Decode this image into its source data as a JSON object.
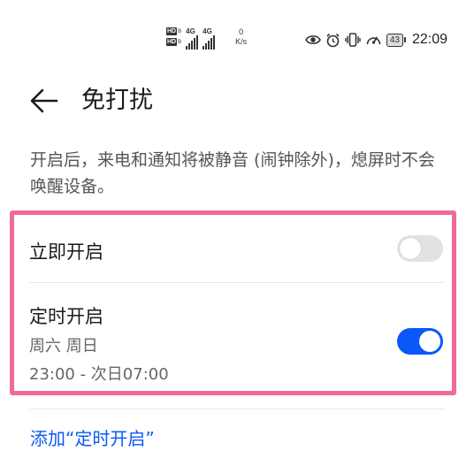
{
  "status_bar": {
    "hd_label": "HD",
    "hd_sub": "B",
    "network_type_1": "4G",
    "network_type_2": "4G",
    "net_speed_value": "0",
    "net_speed_unit": "K/s",
    "battery_level": "43",
    "time": "22:09"
  },
  "header": {
    "title": "免打扰"
  },
  "description": "开启后，来电和通知将被静音 (闹钟除外)，熄屏时不会唤醒设备。",
  "settings": {
    "immediate": {
      "label": "立即开启",
      "enabled": false
    },
    "scheduled": {
      "label": "定时开启",
      "days": "周六 周日",
      "time_range": "23:00 - 次日07:00",
      "enabled": true
    }
  },
  "add_schedule_label": "添加“定时开启”",
  "colors": {
    "accent": "#0a59f7",
    "highlight_border": "#ef6b97",
    "toggle_off": "#e2e2e2"
  }
}
